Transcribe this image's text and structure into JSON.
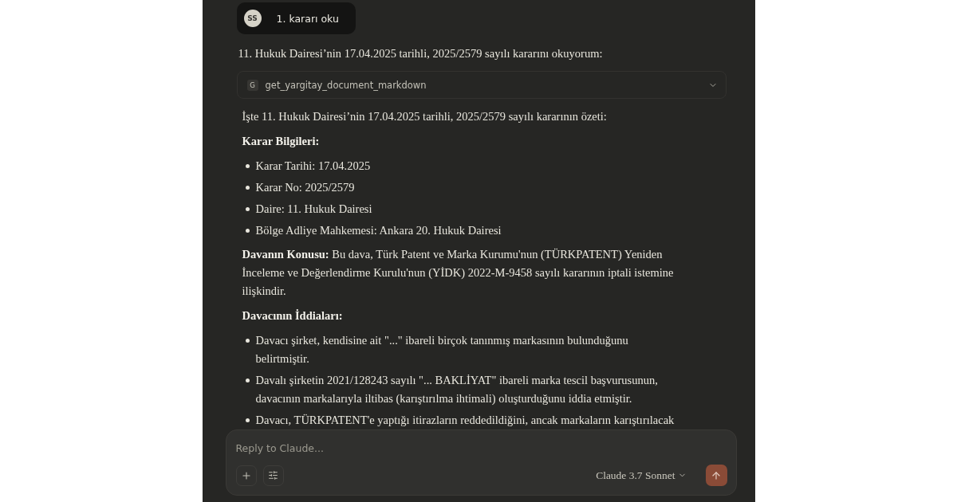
{
  "user_message": {
    "avatar_initials": "SS",
    "text": "1. kararı oku"
  },
  "assistant": {
    "intro": "11. Hukuk Dairesi’nin 17.04.2025 tarihli, 2025/2579 sayılı kararını okuyorum:",
    "tool_call": {
      "badge": "G",
      "name": "get_yargitay_document_markdown",
      "expanded": false
    },
    "blocks": [
      {
        "kind": "paragraph",
        "text": "İşte 11. Hukuk Dairesi’nin 17.04.2025 tarihli, 2025/2579 sayılı kararının özeti:"
      },
      {
        "kind": "heading",
        "text": "Karar Bilgileri:"
      },
      {
        "kind": "list",
        "items": [
          "Karar Tarihi: 17.04.2025",
          "Karar No: 2025/2579",
          "Daire: 11. Hukuk Dairesi",
          "Bölge Adliye Mahkemesi: Ankara 20. Hukuk Dairesi"
        ]
      },
      {
        "kind": "paragraph",
        "text": "**Davanın Konusu:** Bu dava, Türk Patent ve Marka Kurumu'nun (TÜRKPATENT) Yeniden İnceleme ve Değerlendirme Kurulu'nun (YİDK) 2022-M-9458 sayılı kararının iptali istemine ilişkindir."
      },
      {
        "kind": "heading",
        "text": "Davacının İddiaları:"
      },
      {
        "kind": "list",
        "items": [
          "Davacı şirket, kendisine ait \"...\" ibareli birçok tanınmış markasının bulunduğunu belirtmiştir.",
          "Davalı şirketin 2021/128243 sayılı \"... BAKLİYAT\" ibareli marka tescil başvurusunun, davacının markalarıyla iltibas (karıştırılma ihtimali) oluşturduğunu iddia etmiştir.",
          "Davacı, TÜRKPATENT'e yaptığı itirazların reddedildiğini, ancak markaların karıştırılacak"
        ]
      }
    ]
  },
  "composer": {
    "placeholder": "Reply to Claude...",
    "model": "Claude 3.7 Sonnet"
  }
}
